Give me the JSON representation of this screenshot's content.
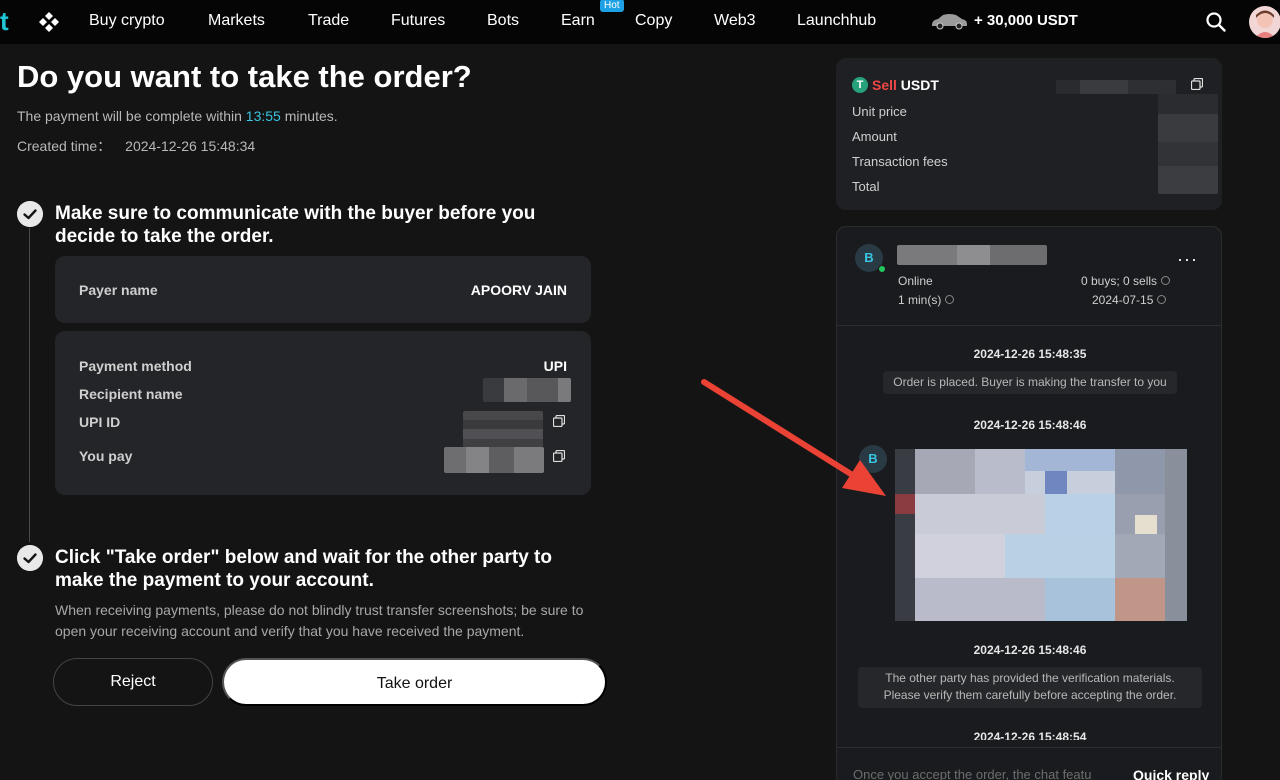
{
  "nav": {
    "brand_letter": "t",
    "items": [
      "Buy crypto",
      "Markets",
      "Trade",
      "Futures",
      "Bots",
      "Earn",
      "Copy",
      "Web3",
      "Launchhub"
    ],
    "hot_badge": "Hot",
    "promo": "+ 30,000 USDT"
  },
  "main": {
    "title": "Do you want to take the order?",
    "payment_prefix": "The payment will be complete within",
    "payment_time": "13:55",
    "payment_suffix": "minutes.",
    "created_label": "Created time：",
    "created_value": "2024-12-26 15:48:34",
    "step1_title": "Make sure to communicate with the buyer before you decide to take the order.",
    "payer_label": "Payer name",
    "payer_value": "APOORV JAIN",
    "payment_method_label": "Payment method",
    "payment_method_value": "UPI",
    "recipient_label": "Recipient name",
    "upi_label": "UPI ID",
    "you_pay_label": "You pay",
    "step2_title": "Click \"Take order\" below and wait for the other party to make the payment to your account.",
    "step2_note": "When receiving payments, please do not blindly trust transfer screenshots; be sure to open your receiving account and verify that you have received the payment.",
    "reject_label": "Reject",
    "take_label": "Take order"
  },
  "summary": {
    "sell_word": "Sell",
    "asset": "USDT",
    "rows": [
      "Unit price",
      "Amount",
      "Transaction fees",
      "Total"
    ]
  },
  "chat": {
    "avatar_letter": "B",
    "status": "Online",
    "response_time": "1 min(s)",
    "trades": "0 buys; 0 sells",
    "joined": "2024-07-15",
    "more": "···",
    "messages": [
      {
        "time": "2024-12-26 15:48:35",
        "text": "Order is placed. Buyer is making the transfer to you"
      },
      {
        "time": "2024-12-26 15:48:46"
      },
      {
        "time": "2024-12-26 15:48:46",
        "text_line1": "The other party has provided the verification materials.",
        "text_line2": "Please verify them carefully before accepting the order."
      },
      {
        "time": "2024-12-26 15:48:54"
      }
    ],
    "input_placeholder": "Once you accept the order, the chat featu",
    "quick_reply": "Quick reply"
  },
  "colors": {
    "accent": "#39c5e0",
    "sell_red": "#ef4646",
    "annotation_arrow": "#ea4335"
  }
}
